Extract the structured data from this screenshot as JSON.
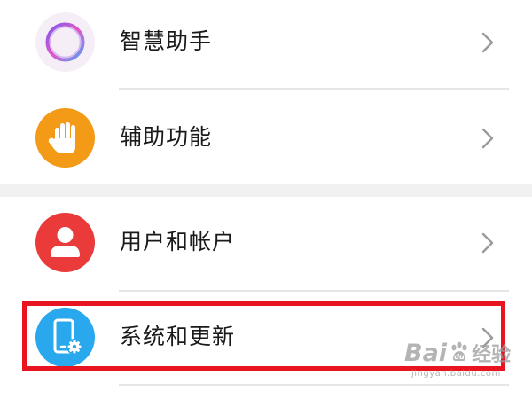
{
  "settings_list": {
    "items": [
      {
        "label": "智慧助手",
        "icon": "assistant-ring-icon",
        "icon_color": "#f5eef6"
      },
      {
        "label": "辅助功能",
        "icon": "hand-icon",
        "icon_color": "#f39a16"
      },
      {
        "label": "用户和帐户",
        "icon": "user-icon",
        "icon_color": "#ea3a3a"
      },
      {
        "label": "系统和更新",
        "icon": "phone-settings-icon",
        "icon_color": "#2aa8ee"
      }
    ],
    "chevron_icon": "chevron-right-icon"
  },
  "colors": {
    "highlight_border": "#e8141f",
    "section_gap": "#f1f1f1",
    "divider": "#e6e6e6"
  },
  "watermark": {
    "main_text_1": "Bai",
    "main_text_2": "经验",
    "sub_text": "jingyan.baidu.com"
  }
}
